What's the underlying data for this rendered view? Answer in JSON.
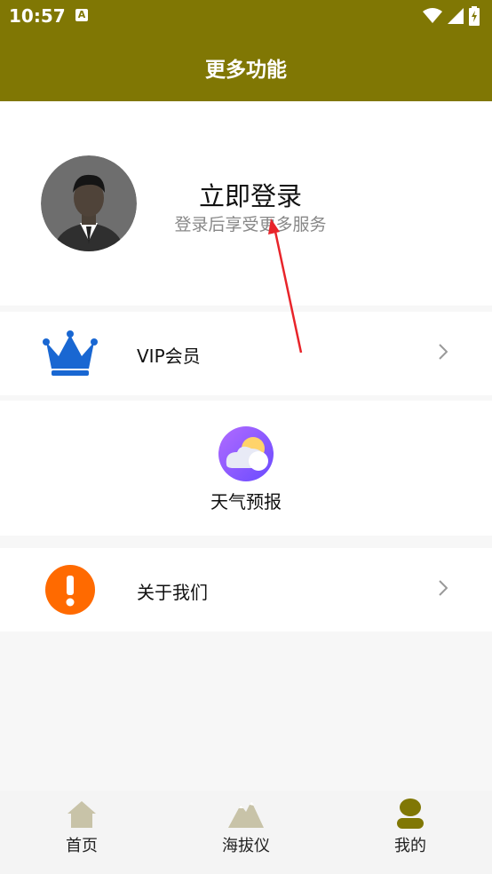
{
  "status_bar": {
    "time": "10:57",
    "notif_letter": "A"
  },
  "header": {
    "title": "更多功能"
  },
  "profile": {
    "title": "立即登录",
    "subtitle": "登录后享受更多服务"
  },
  "menu": {
    "vip": {
      "label": "VIP会员",
      "icon": "crown-icon",
      "color": "#1967d2"
    },
    "weather": {
      "label": "天气预报",
      "icon": "weather-icon"
    },
    "about": {
      "label": "关于我们",
      "icon": "exclamation-icon",
      "color": "#ff6a00"
    }
  },
  "bottom_nav": {
    "items": [
      {
        "label": "首页",
        "icon": "home-icon"
      },
      {
        "label": "海拔仪",
        "icon": "mountain-icon"
      },
      {
        "label": "我的",
        "icon": "user-icon",
        "active": true
      }
    ]
  },
  "colors": {
    "header": "#807704",
    "active_nav": "#807704",
    "inactive_nav": "#c8c3a8"
  }
}
